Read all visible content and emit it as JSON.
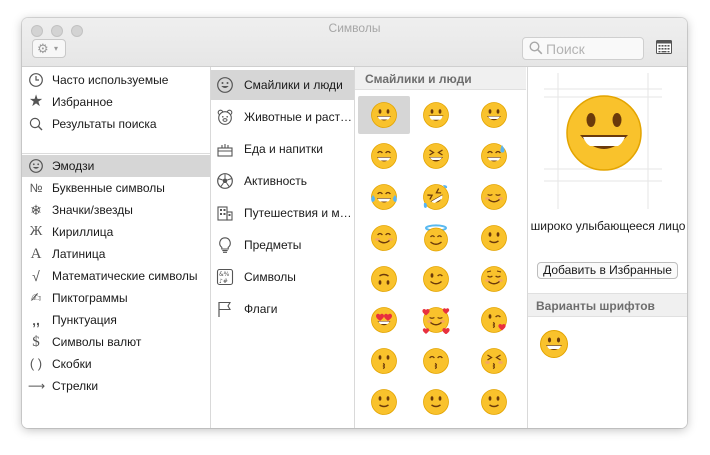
{
  "window": {
    "title": "Символы"
  },
  "toolbar": {
    "search_placeholder": "Поиск"
  },
  "sidebar": {
    "items": [
      {
        "label": "Часто используемые",
        "icon": "clock-icon"
      },
      {
        "label": "Избранное",
        "icon": "star-icon"
      },
      {
        "label": "Результаты поиска",
        "icon": "search-icon"
      },
      {
        "label": "Эмодзи",
        "icon": "smiley-icon",
        "selected": true
      },
      {
        "label": "Буквенные символы",
        "icon": "numero-icon",
        "glyph": "№"
      },
      {
        "label": "Значки/звезды",
        "icon": "snowflake-icon",
        "glyph": "❄"
      },
      {
        "label": "Кириллица",
        "icon": "cyrillic-icon",
        "glyph": "Ж"
      },
      {
        "label": "Латиница",
        "icon": "latin-icon",
        "glyph": "A"
      },
      {
        "label": "Математические символы",
        "icon": "sqrt-icon",
        "glyph": "√"
      },
      {
        "label": "Пиктограммы",
        "icon": "pictograph-icon",
        "glyph": "✍"
      },
      {
        "label": "Пунктуация",
        "icon": "punctuation-icon",
        "glyph": "‚,"
      },
      {
        "label": "Символы валют",
        "icon": "dollar-icon",
        "glyph": "$"
      },
      {
        "label": "Скобки",
        "icon": "brackets-icon",
        "glyph": "( )"
      },
      {
        "label": "Стрелки",
        "icon": "arrow-icon",
        "glyph": "⟶"
      }
    ]
  },
  "categories": [
    {
      "label": "Смайлики и люди",
      "icon": "smiley-icon",
      "selected": true
    },
    {
      "label": "Животные и растения",
      "icon": "bear-icon"
    },
    {
      "label": "Еда и напитки",
      "icon": "cake-icon"
    },
    {
      "label": "Активность",
      "icon": "ball-icon"
    },
    {
      "label": "Путешествия и места",
      "icon": "building-icon"
    },
    {
      "label": "Предметы",
      "icon": "bulb-icon"
    },
    {
      "label": "Символы",
      "icon": "symbols-icon"
    },
    {
      "label": "Флаги",
      "icon": "flag-icon"
    }
  ],
  "emoji_grid": {
    "header": "Смайлики и люди",
    "rows": [
      [
        "grinning",
        "grin",
        "smiley"
      ],
      [
        "smile",
        "laughing",
        "sweat-smile"
      ],
      [
        "joy",
        "rofl",
        "relaxed"
      ],
      [
        "blush",
        "innocent",
        "slight-smile"
      ],
      [
        "upside-down",
        "wink",
        "relieved"
      ],
      [
        "heart-eyes",
        "smiling-hearts",
        "kissing-heart"
      ],
      [
        "kissing",
        "kissing-smiling",
        "kissing-closed"
      ],
      [
        "partial",
        "partial",
        "partial"
      ]
    ]
  },
  "detail": {
    "name": "широко улыбающееся лицо",
    "add_favorites_label": "Добавить в Избранные",
    "variants_header": "Варианты шрифтов"
  },
  "colors": {
    "selection": "#d6d6d6",
    "emoji_face": "#fbc02d",
    "emoji_outline": "#e2a800"
  }
}
